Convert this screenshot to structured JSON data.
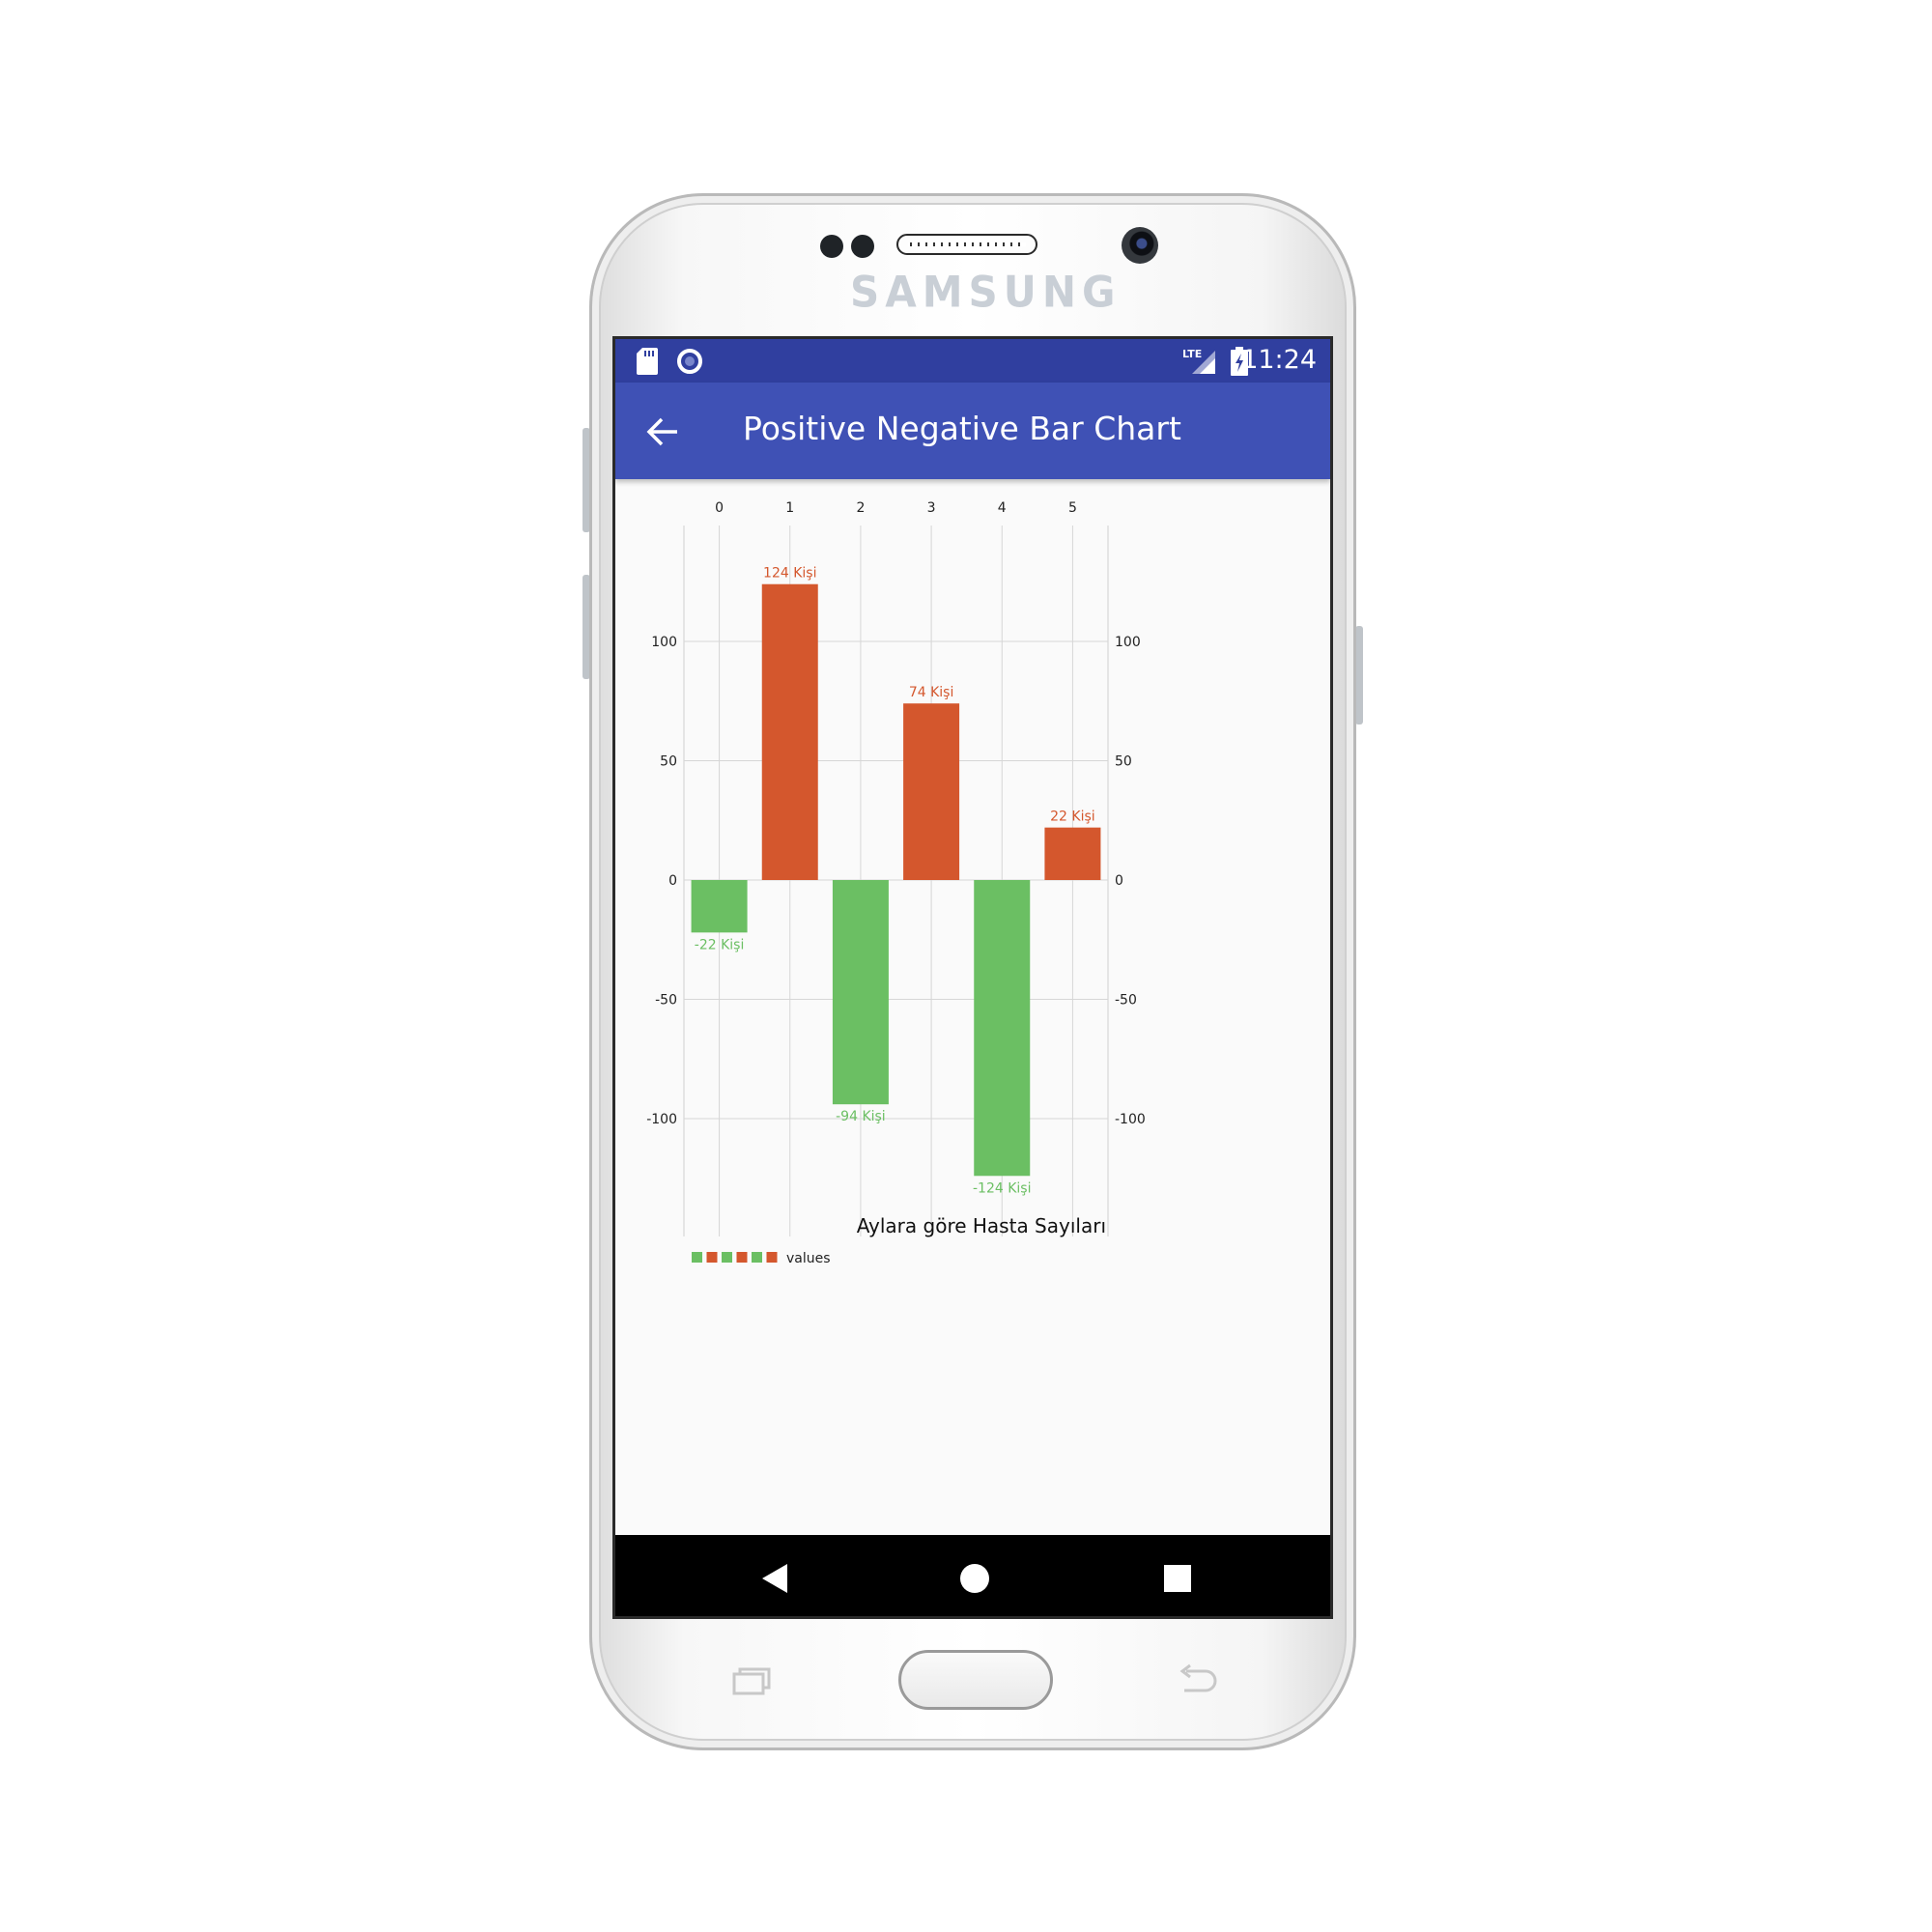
{
  "device": {
    "brand": "SAMSUNG",
    "icons": [
      "sd-card-icon",
      "record-icon",
      "lte-signal-icon",
      "battery-charging-icon",
      "back-icon",
      "home-icon",
      "recents-icon"
    ]
  },
  "status_bar": {
    "time": "11:24",
    "network": "LTE"
  },
  "app_bar": {
    "title": "Positive Negative Bar Chart"
  },
  "colors": {
    "positive": "#d4572d",
    "negative": "#6bbf63",
    "appbar": "#3f51b5",
    "statusbar": "#303f9f"
  },
  "chart_data": {
    "type": "bar",
    "categories": [
      "0",
      "1",
      "2",
      "3",
      "4",
      "5"
    ],
    "values": [
      -22,
      124,
      -94,
      74,
      -124,
      22
    ],
    "value_labels": [
      "-22 Kişi",
      "124 Kişi",
      "-94 Kişi",
      "74 Kişi",
      "-124 Kişi",
      "22 Kişi"
    ],
    "description": "Aylara göre Hasta Sayıları",
    "legend": {
      "label": "values",
      "position": "bottom-left"
    },
    "y_ticks": [
      "100",
      "50",
      "0",
      "-50",
      "-100"
    ],
    "y_tick_values": [
      100,
      50,
      0,
      -50,
      -100
    ],
    "ylim": [
      -150,
      150
    ],
    "xaxis_position": "top",
    "yaxis": "both sides",
    "grid": true
  }
}
